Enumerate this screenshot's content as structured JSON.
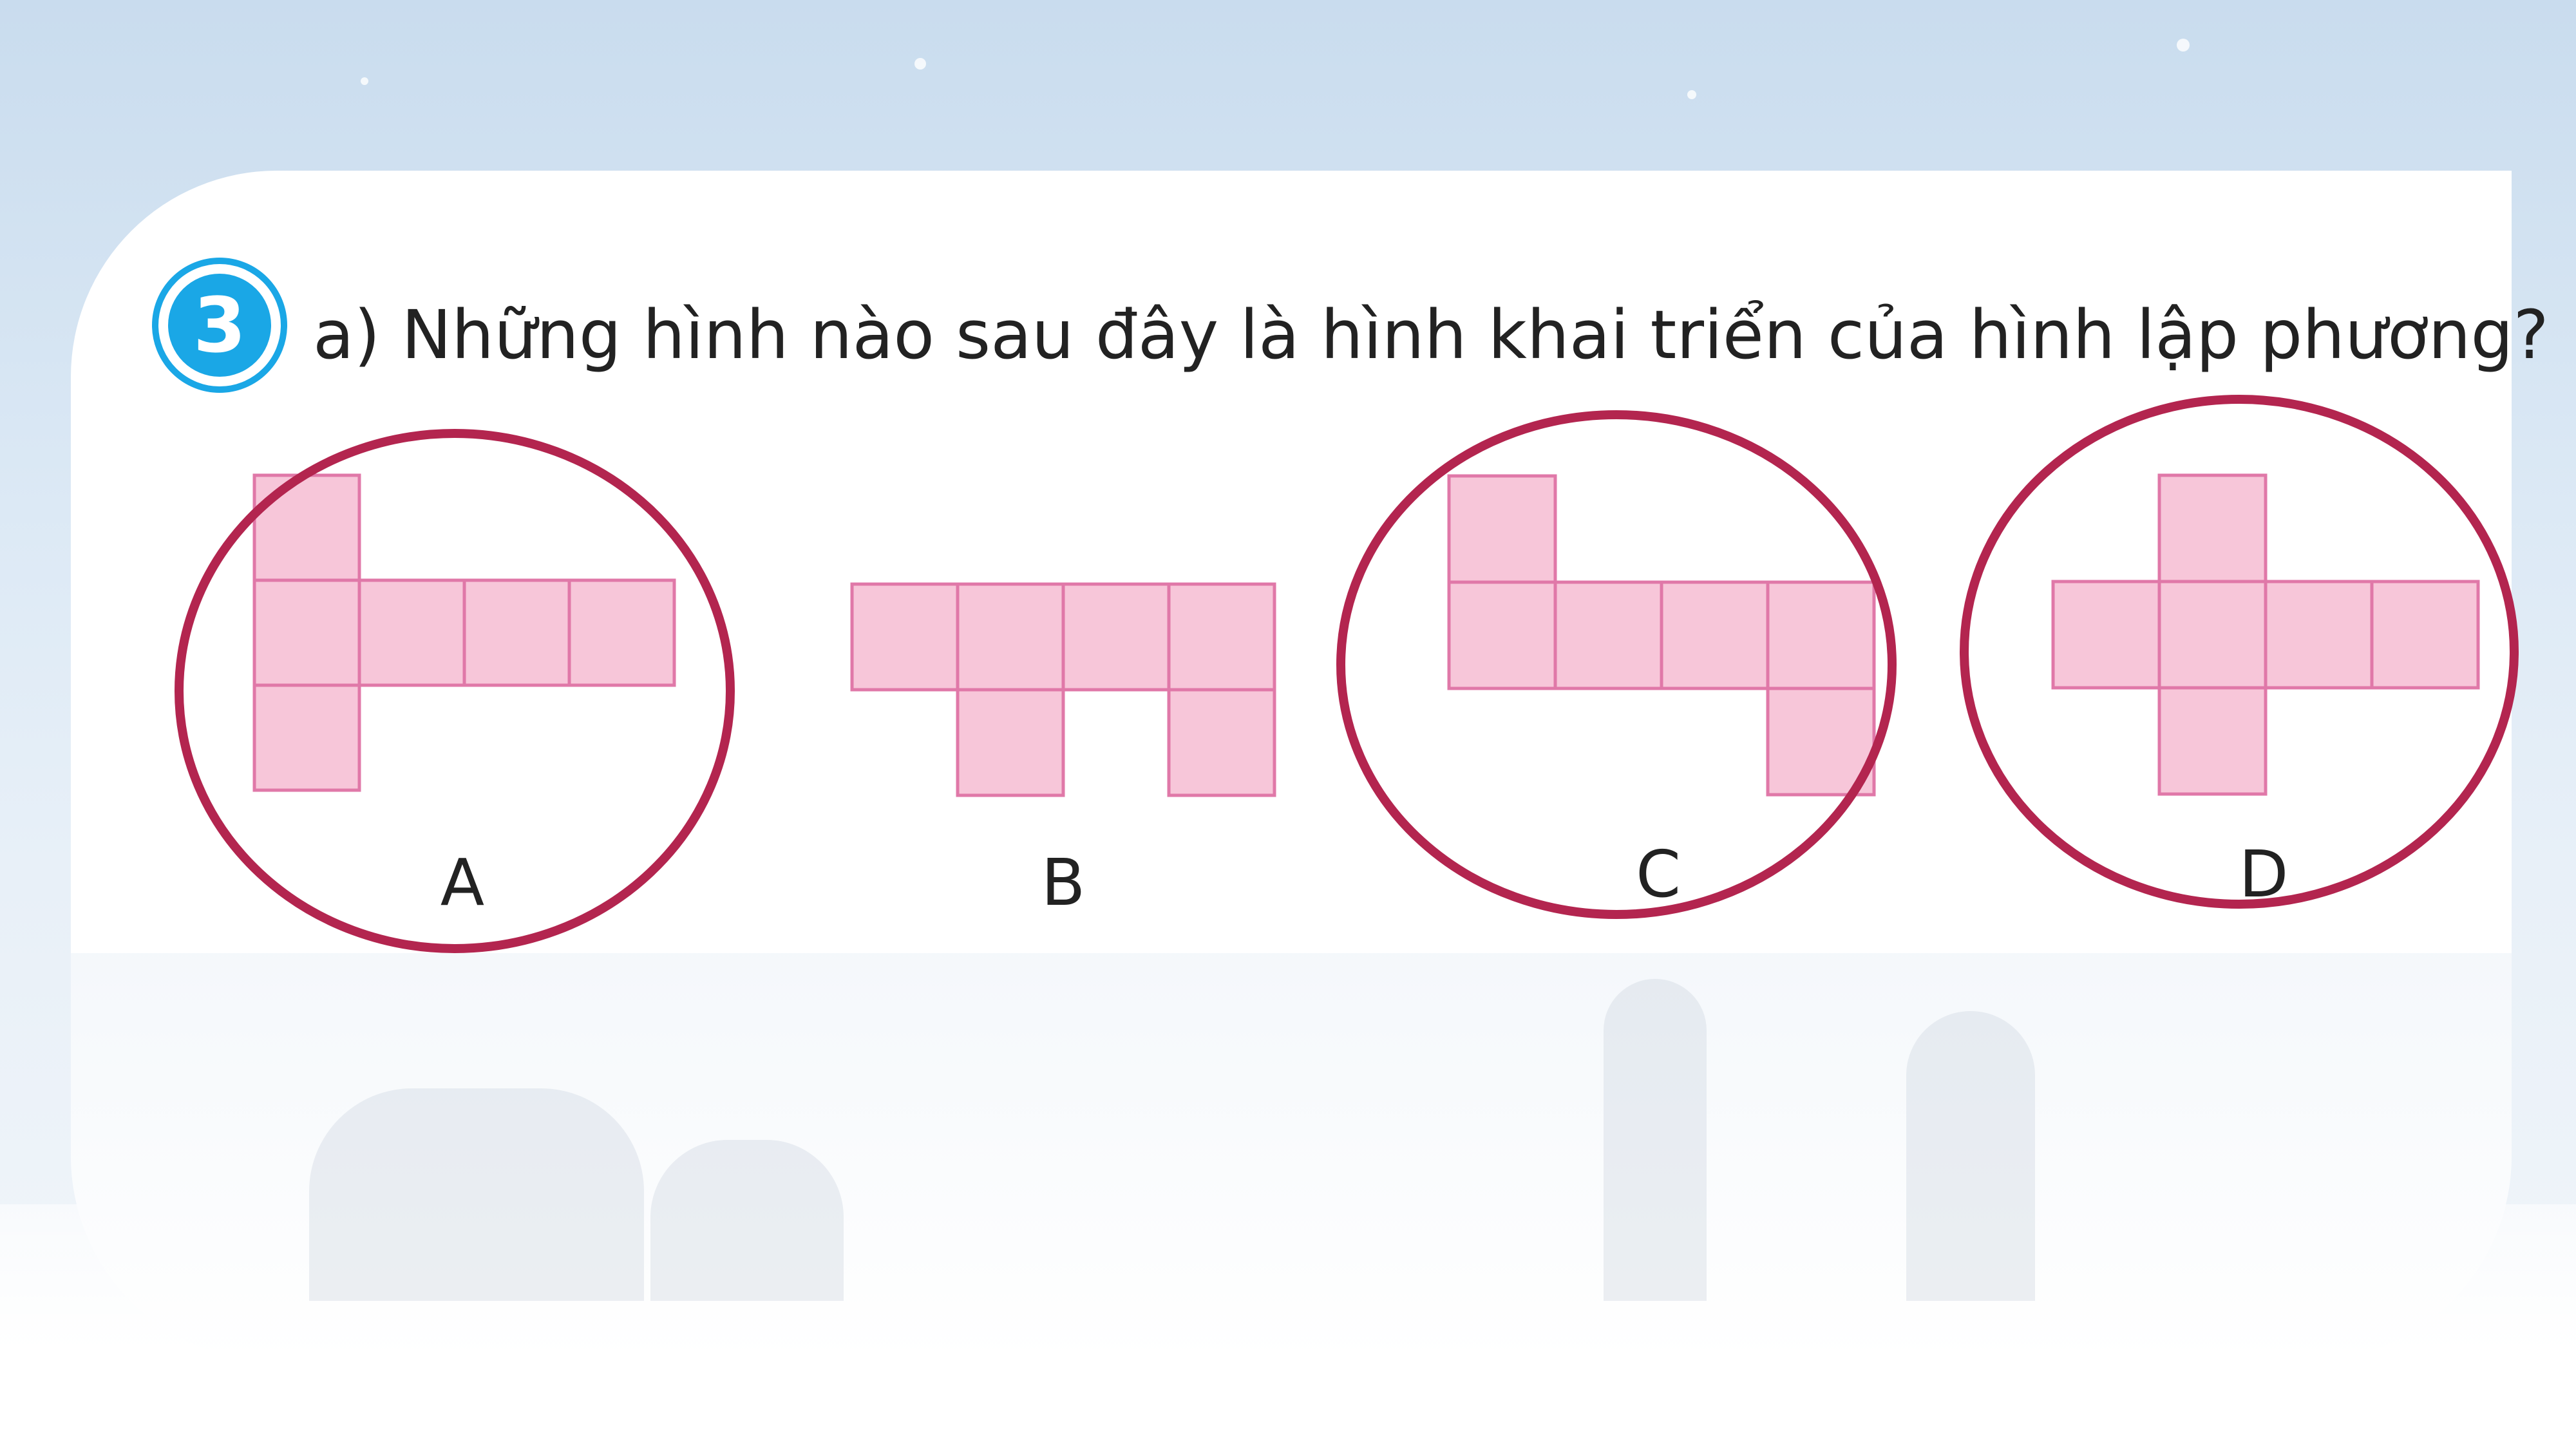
{
  "exercise": {
    "number": "3",
    "question": "a) Những hình nào sau đây là hình khai triển của hình lập phương?"
  },
  "options": [
    {
      "id": "A",
      "label": "A",
      "circled": true
    },
    {
      "id": "B",
      "label": "B",
      "circled": false
    },
    {
      "id": "C",
      "label": "C",
      "circled": true
    },
    {
      "id": "D",
      "label": "D",
      "circled": true
    }
  ],
  "colors": {
    "square_fill": "#f7c6d9",
    "square_stroke": "#e078a8",
    "circle_stroke": "#b3254f",
    "badge": "#1aa7e6"
  }
}
